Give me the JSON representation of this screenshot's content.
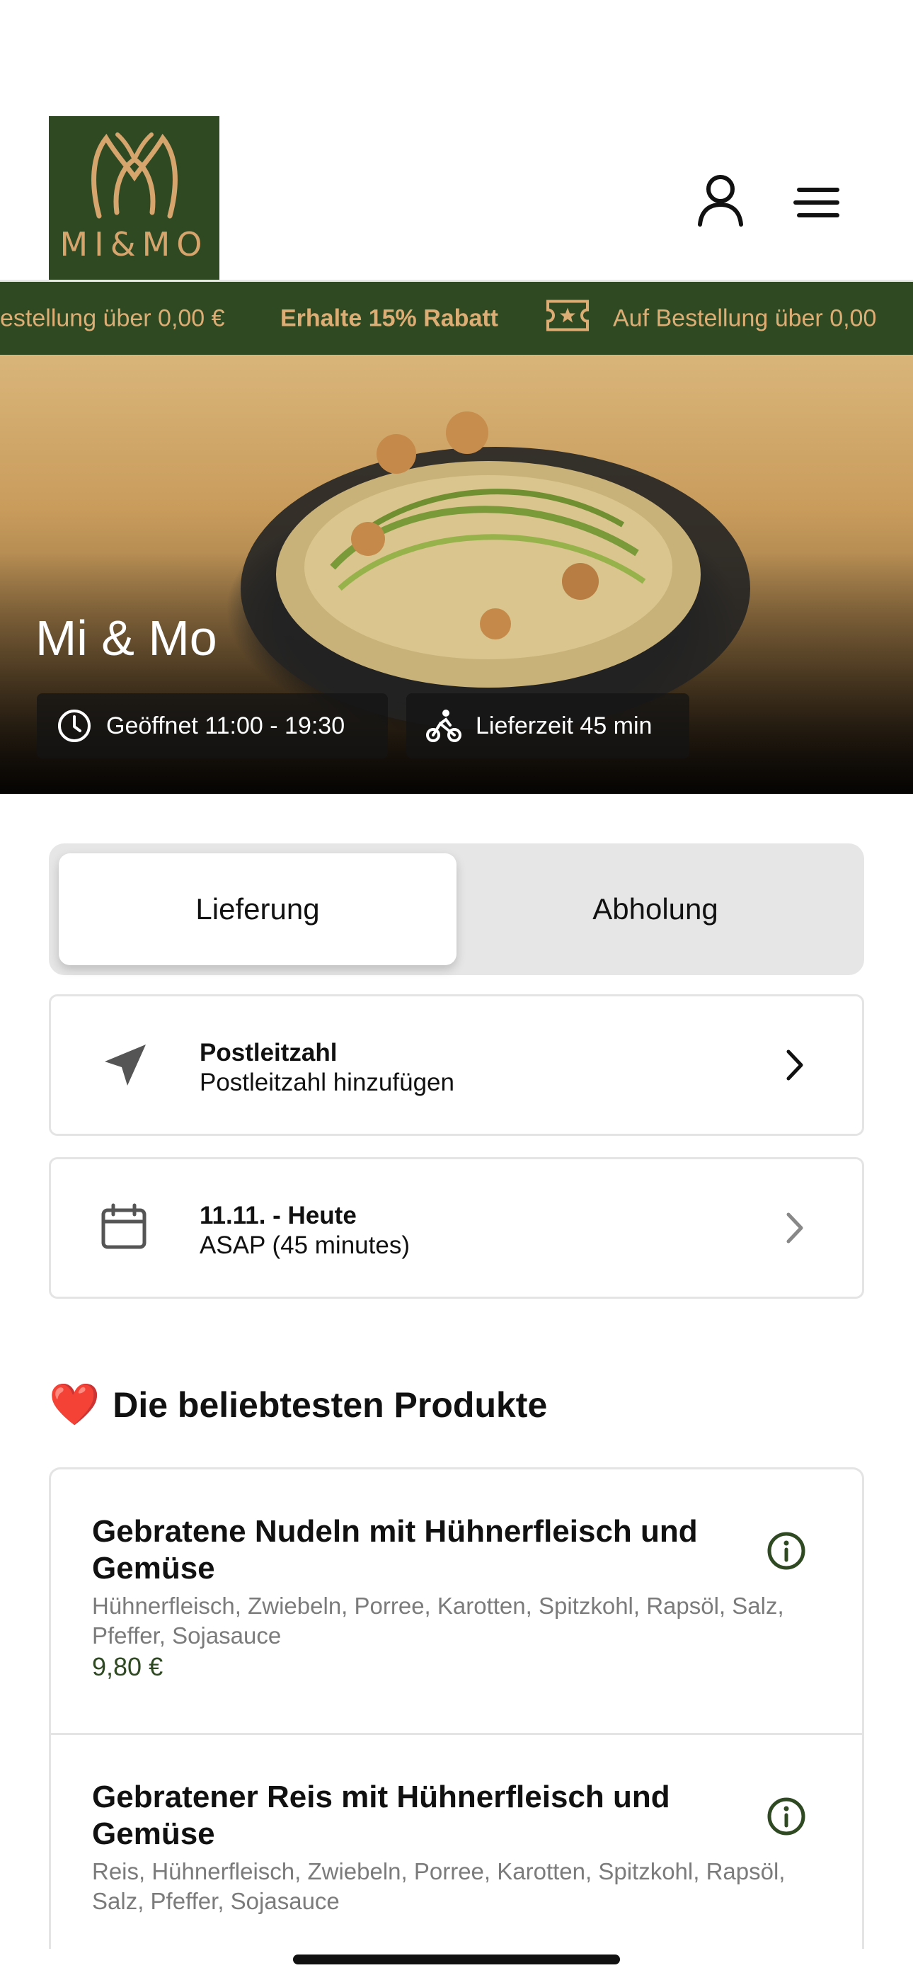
{
  "brand": {
    "logo_text": "MI&MO",
    "colors": {
      "primary": "#2f4a22",
      "accent": "#d6a56e"
    }
  },
  "header": {
    "user_icon": "user-icon",
    "menu_icon": "hamburger-menu-icon"
  },
  "promo": {
    "left_fragment": "estellung über 0,00 €",
    "highlight": "Erhalte 15% Rabatt",
    "right_fragment": "Auf Bestellung über 0,00",
    "icon": "ticket-star-icon"
  },
  "restaurant": {
    "name": "Mi & Mo",
    "hours": "Geöffnet 11:00 - 19:30",
    "delivery_time": "Lieferzeit 45 min"
  },
  "order_mode": {
    "tabs": [
      {
        "label": "Lieferung",
        "selected": true
      },
      {
        "label": "Abholung",
        "selected": false
      }
    ]
  },
  "postcode": {
    "title": "Postleitzahl",
    "subtitle": "Postleitzahl hinzufügen"
  },
  "schedule": {
    "title": "11.11. - Heute",
    "subtitle": "ASAP (45 minutes)"
  },
  "popular": {
    "heading": "Die beliebtesten Produkte",
    "emoji": "❤️",
    "products": [
      {
        "name": "Gebratene Nudeln mit Hühnerfleisch und Gemüse",
        "description": "Hühnerfleisch, Zwiebeln, Porree, Karotten, Spitzkohl, Rapsöl, Salz, Pfeffer, Sojasauce",
        "price": "9,80 €"
      },
      {
        "name": "Gebratener Reis mit Hühnerfleisch und Gemüse",
        "description": "Reis, Hühnerfleisch, Zwiebeln, Porree, Karotten, Spitzkohl, Rapsöl, Salz, Pfeffer, Sojasauce"
      }
    ]
  }
}
